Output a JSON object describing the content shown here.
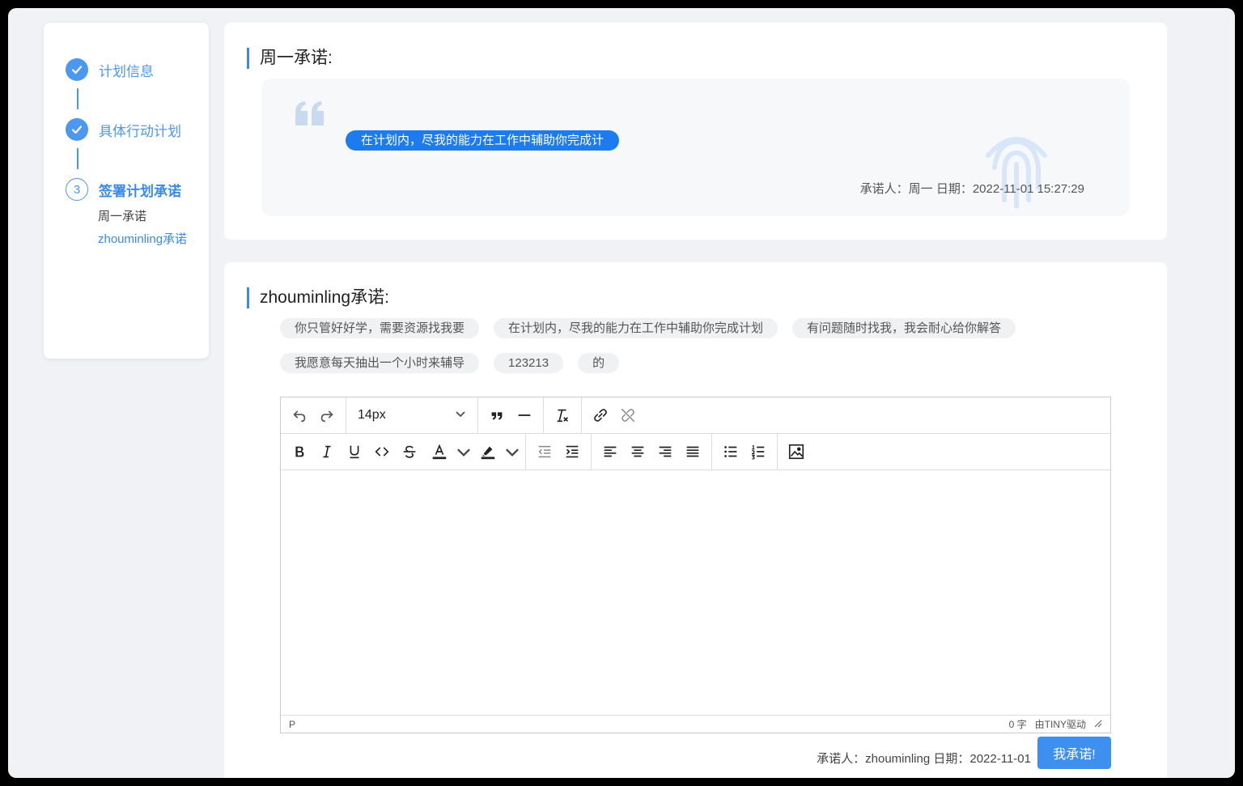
{
  "steps": [
    {
      "label": "计划信息",
      "status": "done"
    },
    {
      "label": "具体行动计划",
      "status": "done"
    },
    {
      "label": "签署计划承诺",
      "status": "current",
      "number": "3"
    }
  ],
  "sub_items": [
    "周一承诺",
    "zhouminling承诺"
  ],
  "card1": {
    "title": "周一承诺:",
    "pledge": "在计划内，尽我的能力在工作中辅助你完成计",
    "signer": "承诺人：周一  日期：2022-11-01 15:27:29"
  },
  "card2": {
    "title": "zhouminling承诺:",
    "tags_row1": [
      "你只管好好学，需要资源找我要",
      "在计划内，尽我的能力在工作中辅助你完成计划",
      "有问题随时找我，我会耐心给你解答"
    ],
    "tags_row2": [
      "我愿意每天抽出一个小时来辅导",
      "123213",
      "的"
    ],
    "editor": {
      "font_size": "14px",
      "status_path": "P",
      "word_count": "0 字",
      "powered_by": "由TINY驱动"
    },
    "signer": "承诺人：zhouminling  日期：2022-11-01",
    "submit_label": "我承诺!"
  },
  "colors": {
    "accent": "#3a8ae9",
    "pill": "#1b7bef",
    "button": "#3d8ff0"
  }
}
